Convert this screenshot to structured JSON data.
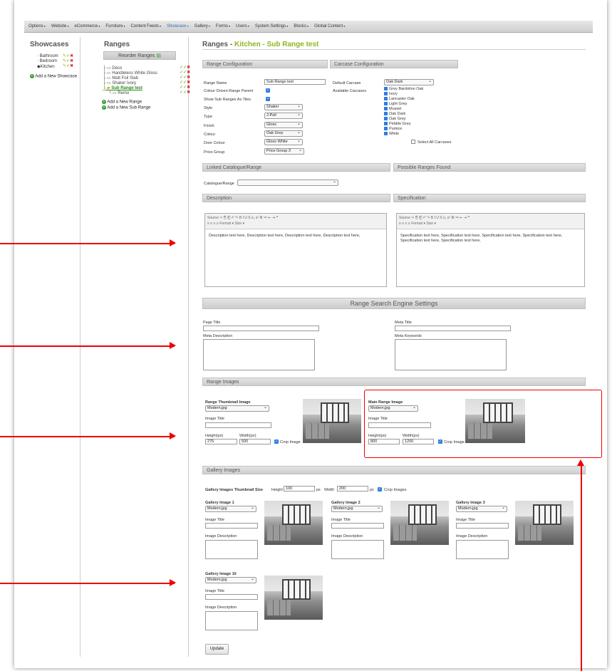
{
  "menu": [
    "Options",
    "Website",
    "eCommerce",
    "Furniture",
    "Content Feeds",
    "Showcase",
    "Gallery",
    "Forms",
    "Users",
    "System Settings",
    "Blocks",
    "Global Content"
  ],
  "active_menu": "Showcase",
  "showcases": {
    "heading": "Showcases",
    "items": [
      "Bathroom",
      "Bedroom",
      "Kitchen"
    ],
    "add": "Add a New Showcase"
  },
  "ranges": {
    "heading": "Ranges",
    "reorder": "Reorder Ranges",
    "items": [
      "Deco",
      "Handleless White Gloss",
      "Matt Foil Slab",
      "Shaker Ivory",
      "Sub Range test",
      "Remo"
    ],
    "add_range": "Add a New Range",
    "add_sub": "Add a New Sub Range"
  },
  "page": {
    "title_prefix": "Ranges - ",
    "title_highlight": "Kitchen - Sub Range test"
  },
  "range_config": {
    "header": "Range Configuration",
    "name_label": "Range Name",
    "name_value": "Sub Range test",
    "colour_parent_label": "Colour Driven Range Parent",
    "show_sub_label": "Show Sub Ranges As Tiles",
    "style_label": "Style",
    "style_value": "Shaker",
    "type_label": "Type",
    "type_value": "J-Pull",
    "finish_label": "Finish",
    "finish_value": "Gloss",
    "colour_label": "Colour",
    "colour_value": "Oak Grey",
    "door_colour_label": "Door Colour",
    "door_colour_value": "Gloss White",
    "price_label": "Price Group",
    "price_value": "Price Group 3"
  },
  "carcase": {
    "header": "Carcase Configuration",
    "default_label": "Default Carcase",
    "default_value": "Oak Dark",
    "available_label": "Available Carcases",
    "items": [
      "Grey Bardolino Oak",
      "Ivory",
      "Lancaster Oak",
      "Light Grey",
      "Mussel",
      "Oak Dark",
      "Oak Grey",
      "Pebble Grey",
      "Pumice",
      "White"
    ],
    "select_all": "Select All Carcases"
  },
  "linked": {
    "header": "Linked Catalogue/Range",
    "found": "Possible Ranges Found",
    "label": "Catalogue/Range"
  },
  "desc": {
    "header": "Description",
    "spec_header": "Specification",
    "toolbar1": "Source  ✂ ⎘ ⎗  ↶ ↷   B I U S  x₂ x²  ≣ ≔  ⇤ ⇥ ❞",
    "toolbar2": "≡ ≡ ≡ ≡   Format ▾   Size ▾",
    "desc_text": "Description text here, Description text here, Description text here, Description text here,",
    "spec_text": "Specification text here, Specification text here, Specification text here, Specification text here, Specification text here, Specification text here,"
  },
  "seo": {
    "header": "Range Search Engine Settings",
    "page_title": "Page Title",
    "meta_title": "Meta Title",
    "meta_desc": "Meta Description",
    "meta_keywords": "Meta Keywords"
  },
  "range_images": {
    "header": "Range Images",
    "thumb_label": "Range Thumbnail Image",
    "thumb_file": "Modern.jpg",
    "main_label": "Main Range Image",
    "main_file": "Modern.jpg",
    "image_title": "Image Title",
    "height_label": "Height(px)",
    "width_label": "Width(px)",
    "thumb_h": "275",
    "thumb_w": "500",
    "main_h": "800",
    "main_w": "1200",
    "crop": "Crop Image"
  },
  "gallery": {
    "header": "Gallery Images",
    "size_label": "Gallery Images Thumbnail Size",
    "height": "Height",
    "height_val": "100",
    "width": "Width",
    "width_val": "200",
    "px": "px",
    "crop": "Crop Images",
    "items": [
      {
        "label": "Gallery Image 1",
        "file": "Modern.jpg"
      },
      {
        "label": "Gallery Image 2",
        "file": "Modern.jpg"
      },
      {
        "label": "Gallery Image 3",
        "file": "Modern.jpg"
      },
      {
        "label": "Gallery Image 10",
        "file": "Modern.jpg"
      }
    ],
    "image_title": "Image Title",
    "image_desc": "Image Description"
  },
  "update": "Update",
  "colors": {
    "highlight": "#8ab81e",
    "annotation": "#e00000",
    "checkbox": "#2f7de0"
  }
}
